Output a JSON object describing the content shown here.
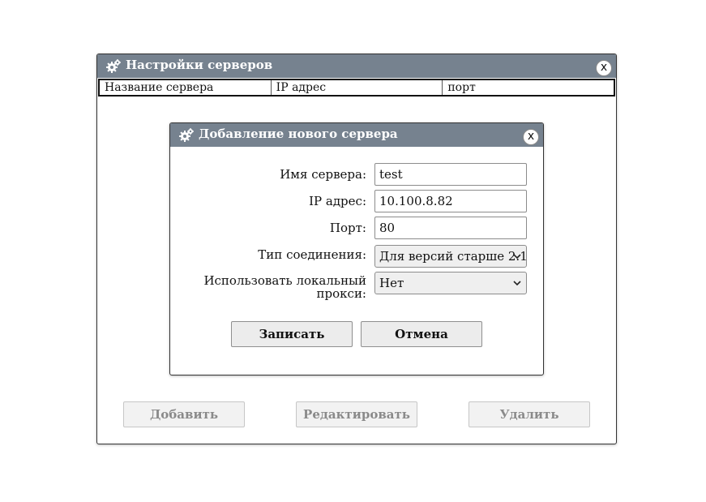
{
  "main_window": {
    "title": "Настройки серверов",
    "close_label": "x",
    "columns": [
      "Название сервера",
      "IP адрес",
      "порт"
    ],
    "buttons": {
      "add": "Добавить",
      "edit": "Редактировать",
      "delete": "Удалить"
    }
  },
  "dialog": {
    "title": "Добавление нового сервера",
    "close_label": "x",
    "fields": {
      "server_name": {
        "label": "Имя сервера:",
        "value": "test"
      },
      "ip": {
        "label": "IP адрес:",
        "value": "10.100.8.82"
      },
      "port": {
        "label": "Порт:",
        "value": "80"
      },
      "connection_type": {
        "label": "Тип соединения:",
        "value": "Для версий старше 2.1"
      },
      "use_proxy": {
        "label_line1": "Использовать локальный",
        "label_line2": "прокси:",
        "value": "Нет"
      }
    },
    "buttons": {
      "save": "Записать",
      "cancel": "Отмена"
    }
  },
  "colors": {
    "titlebar": "#76828f",
    "disabled_text": "#8a8a8a"
  },
  "icons": {
    "title_icon": "gears-icon",
    "select_icon": "chevron-down-icon"
  }
}
